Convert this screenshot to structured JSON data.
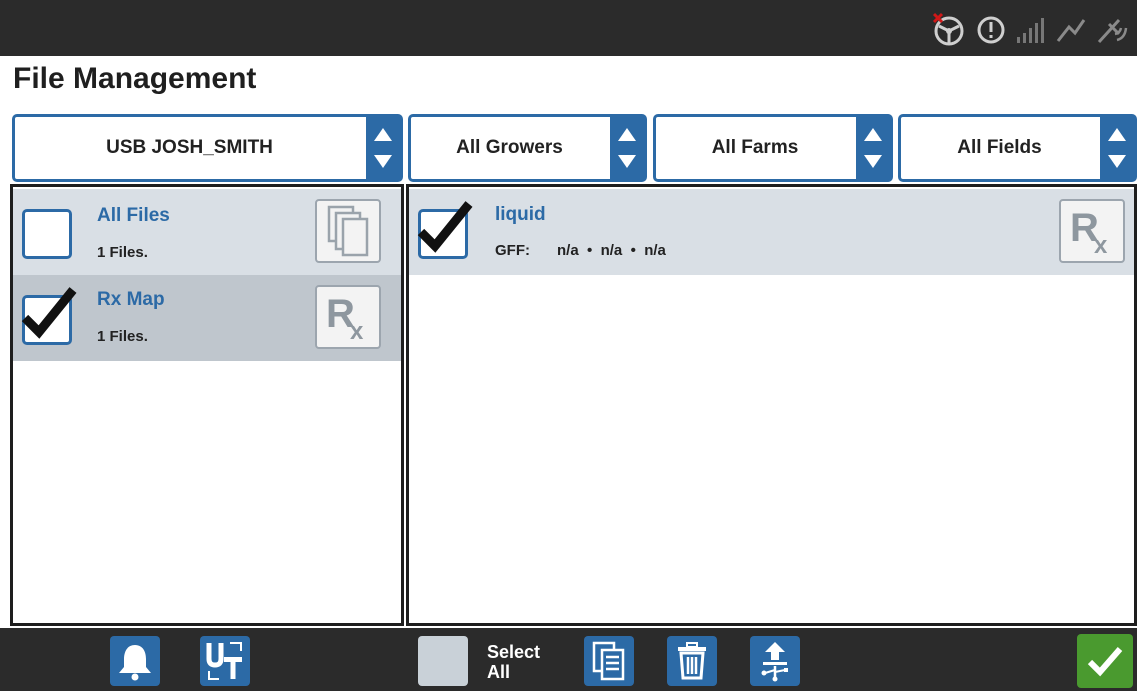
{
  "header": {
    "title": "File Management"
  },
  "status_icons": [
    "steering-disabled-icon",
    "alert-icon",
    "signal-bars-icon",
    "antenna-icon",
    "gps-satellite-icon"
  ],
  "filters": {
    "source": "USB JOSH_SMITH",
    "grower": "All Growers",
    "farm": "All Farms",
    "field": "All Fields"
  },
  "categories": [
    {
      "title": "All Files",
      "count": "1 Files.",
      "checked": false,
      "icon": "copy-files-icon"
    },
    {
      "title": "Rx Map",
      "count": "1 Files.",
      "checked": true,
      "icon": "rx-icon"
    }
  ],
  "files": [
    {
      "name": "liquid",
      "gff_label": "GFF:",
      "gff_values": "n/a  •  n/a  •  n/a",
      "checked": true,
      "icon": "rx-icon"
    }
  ],
  "bottom_bar": {
    "select_all_line1": "Select",
    "select_all_line2": "All",
    "icons": [
      "bell-icon",
      "ut-icon",
      "file-list-icon",
      "trash-icon",
      "usb-export-icon",
      "confirm-check-icon"
    ]
  },
  "colors": {
    "accent": "#2c6aa6",
    "bar": "#2b2b2b",
    "selected_row": "#bfc6cd",
    "ok": "#4a9a2f"
  }
}
